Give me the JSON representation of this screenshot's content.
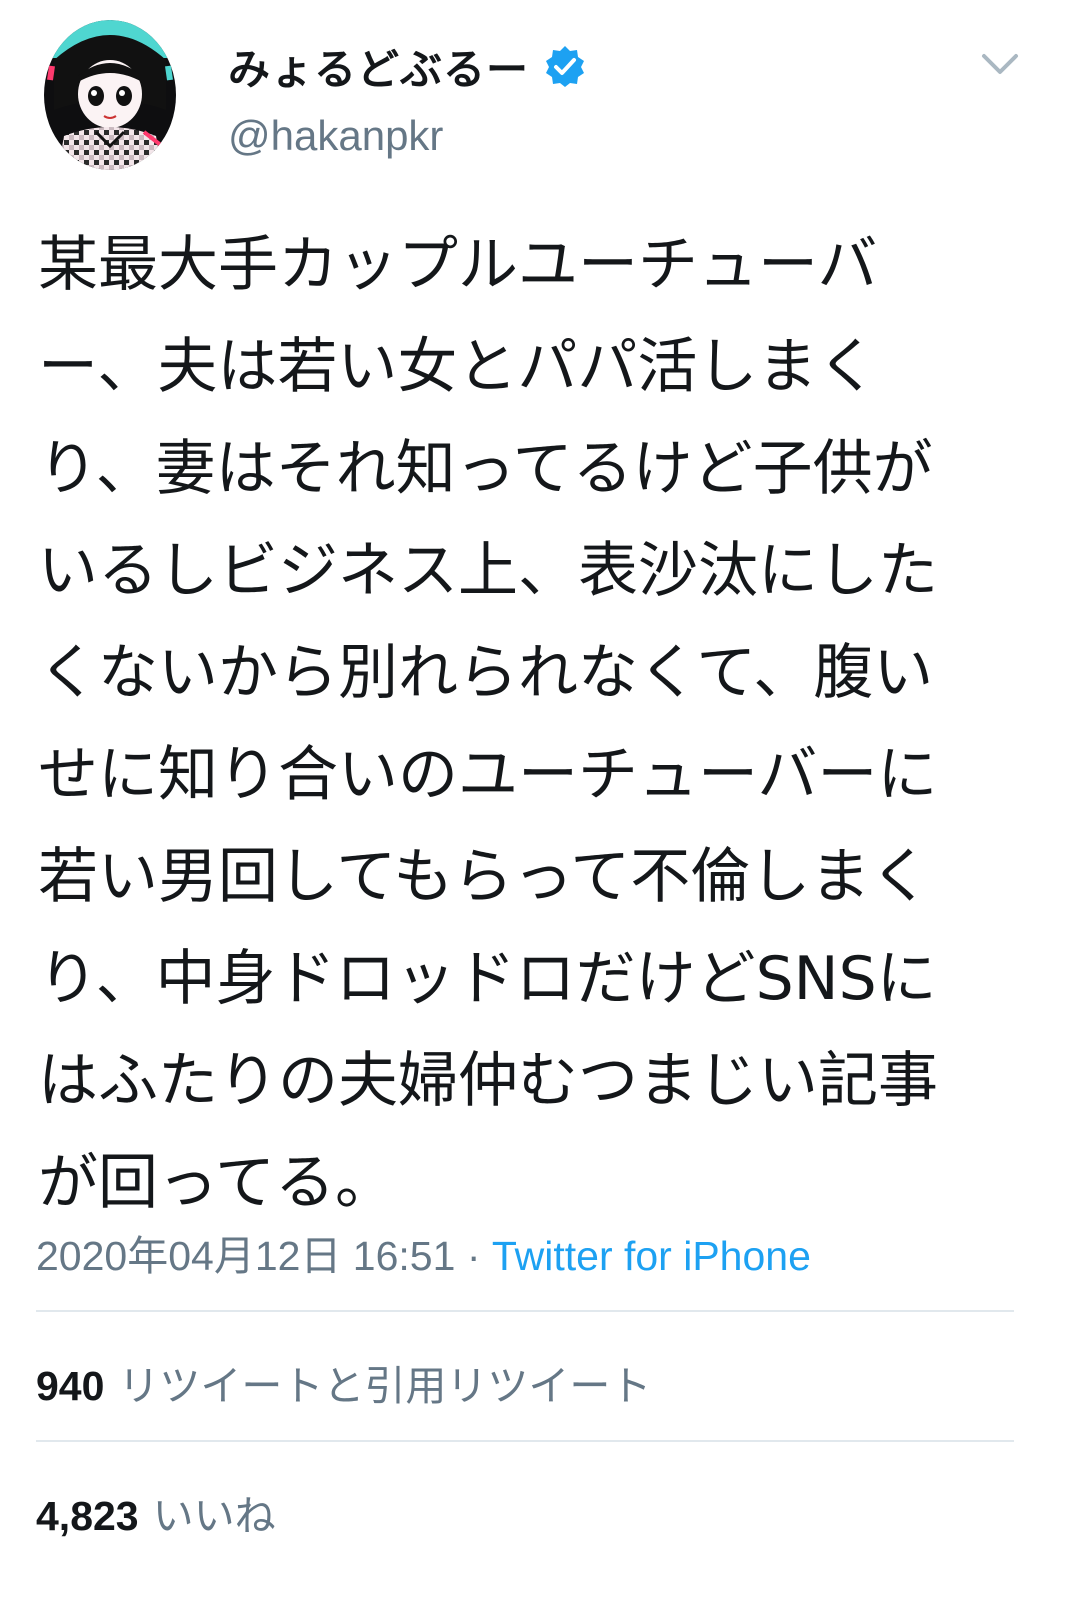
{
  "user": {
    "display_name": "みょるどぶるー",
    "handle": "@hakanpkr",
    "verified": true,
    "avatar_icon": "anime-girl-avatar"
  },
  "tweet": {
    "lines": [
      "某最大手カップルユーチューバ",
      "ー、夫は若い女とパパ活しまく",
      "り、妻はそれ知ってるけど子供が",
      "いるしビジネス上、表沙汰にした",
      "くないから別れられなくて、腹い",
      "せに知り合いのユーチューバーに",
      "若い男回してもらって不倫しまく",
      "り、中身ドロッドロだけどSNSに",
      "はふたりの夫婦仲むつまじい記事",
      "が回ってる。"
    ],
    "timestamp": "2020年04月12日 16:51",
    "separator": " · ",
    "source": "Twitter for iPhone"
  },
  "stats": {
    "retweets_count": "940",
    "retweets_label": "リツイートと引用リツイート",
    "likes_count": "4,823",
    "likes_label": "いいね"
  },
  "colors": {
    "text": "#14171a",
    "secondary": "#657786",
    "accent": "#1da1f2",
    "divider": "#e1e8ed"
  },
  "icons": {
    "verified": "verified-badge-icon",
    "menu": "chevron-down-icon"
  }
}
